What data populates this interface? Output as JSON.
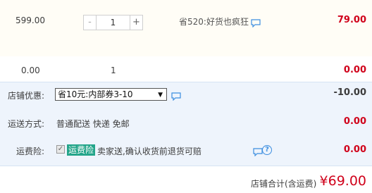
{
  "item": {
    "unit_price": "599.00",
    "quantity": "1",
    "minus_label": "-",
    "plus_label": "+",
    "promotion": "省520:好货也疯狂",
    "total": "79.00"
  },
  "subtotal": {
    "price": "0.00",
    "quantity": "1",
    "total": "0.00"
  },
  "discount": {
    "label": "店铺优惠:",
    "selected": "省10元:内部券3-10",
    "value": "-10.00"
  },
  "shipping": {
    "label": "运送方式:",
    "method": "普通配送 快递 免邮",
    "value": "0.00"
  },
  "insurance": {
    "label": "运费险:",
    "tag": "运费险",
    "description": "卖家送,确认收货前退货可赔",
    "value": "0.00",
    "help_glyph": "?"
  },
  "store_total": {
    "label": "店铺合计(含运费)",
    "value": "¥69.00"
  },
  "colors": {
    "price_red": "#d0021b",
    "info_bg": "#eef4fc",
    "tag_green": "#24a58a",
    "icon_blue": "#3c8ee0"
  }
}
